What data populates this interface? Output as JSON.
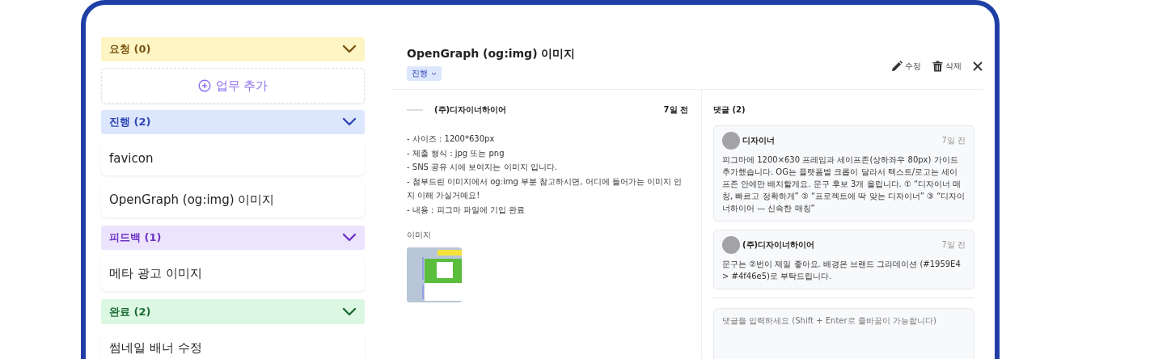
{
  "groups": [
    {
      "kind": "request",
      "label": "요청 (0)",
      "expanded": true,
      "add_button": "업무 추가"
    },
    {
      "kind": "progress",
      "label": "진행 (2)",
      "expanded": true,
      "cards": [
        {
          "title": "favicon"
        },
        {
          "title": "OpenGraph (og:img) 이미지"
        }
      ]
    },
    {
      "kind": "feedback",
      "label": "피드백 (1)",
      "expanded": true,
      "cards": [
        {
          "title": "메타 광고 이미지"
        }
      ]
    },
    {
      "kind": "done",
      "label": "완료 (2)",
      "expanded": true,
      "cards": [
        {
          "title": "썸네일 배너 수정"
        }
      ]
    }
  ],
  "detail": {
    "title": "OpenGraph (og:img) 이미지",
    "status": {
      "kind": "progress",
      "label": "진행"
    },
    "actions": [
      {
        "kind": "edit",
        "label": "수정"
      },
      {
        "kind": "delete",
        "label": "삭제"
      }
    ],
    "post": {
      "author": "(주)디자이너하이어",
      "time": "7일 전",
      "lines": [
        "- 사이즈 : 1200*630px",
        "- 제출 형식 : jpg 또는 png",
        "- SNS 공유 시에 보여지는 이미지 입니다.",
        "- 첨부드린 이미지에서 og:img 부분 참고하시면, 어디에 들어가는 이미지 인지 이해 가실거예요!",
        "- 내용 : 피그마 파일에 기입 완료"
      ],
      "attachment_label": "이미지"
    },
    "comments_title": "댓글 (2)",
    "comments": [
      {
        "author": "디자이너",
        "time": "7일 전",
        "text": "피그마에 1200×630 프레임과 세이프존(상하좌우 80px) 가이드 추가했습니다. OG는 플랫폼별 크롭이 달라서 텍스트/로고는 세이프존 안에만 배치할게요. 문구 후보 3개 올립니다. ① “디자이너 매칭, 빠르고 정확하게” ② “프로젝트에 딱 맞는 디자이너” ③ “디자이너하이어 — 신속한 매칭”"
      },
      {
        "author": "(주)디자이너하이어",
        "time": "7일 전",
        "text": "문구는 ②번이 제일 좋아요. 배경은 브랜드 그라데이션 (#1959E4 > #4f46e5)로 부탁드립니다."
      }
    ],
    "comment_input": {
      "placeholder": "댓글을 입력하세요 (Shift + Enter로 줄바꿈이 가능합니다)"
    }
  }
}
